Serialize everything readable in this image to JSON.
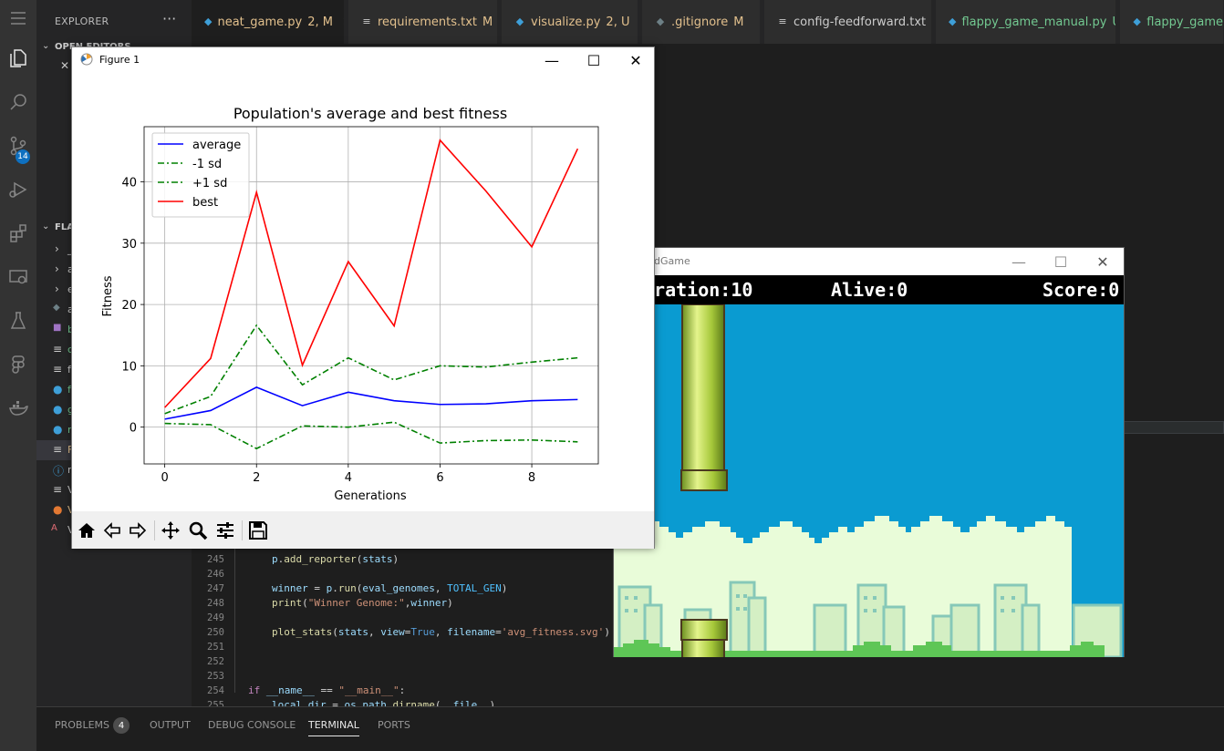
{
  "sidebar": {
    "title": "EXPLORER",
    "more": "···",
    "open_editors": "OPEN EDITORS",
    "folder": "FLA",
    "rows": [
      "_",
      "a",
      "e",
      "a",
      "b",
      "c",
      "f",
      "f",
      "g",
      "r",
      "F",
      "r",
      "V",
      "V"
    ]
  },
  "activity": {
    "scm_badge": "14"
  },
  "tabs": [
    {
      "label": "neat_game.py",
      "mod": "2, M",
      "icon": "python-icon",
      "close": "✕"
    },
    {
      "label": "requirements.txt",
      "mod": "M",
      "icon": "text-file-icon"
    },
    {
      "label": "visualize.py",
      "mod": "2, U",
      "icon": "python-icon"
    },
    {
      "label": ".gitignore",
      "mod": "M",
      "icon": "git-icon"
    },
    {
      "label": "config-feedforward.txt",
      "mod": "",
      "icon": "text-file-icon"
    },
    {
      "label": "flappy_game_manual.py",
      "mod": "U",
      "icon": "python-icon"
    },
    {
      "label": "flappy_game",
      "mod": "",
      "icon": "python-icon"
    }
  ],
  "editor": {
    "lines": [
      {
        "n": "245",
        "code": "p.add_reporter(stats)"
      },
      {
        "n": "246",
        "code": ""
      },
      {
        "n": "247",
        "code": "winner = p.run(eval_genomes, TOTAL_GEN)"
      },
      {
        "n": "248",
        "code": "print(\"Winner Genome:\",winner)"
      },
      {
        "n": "249",
        "code": ""
      },
      {
        "n": "250",
        "code": "plot_stats(stats, view=True, filename='avg_fitness.svg')"
      },
      {
        "n": "251",
        "code": ""
      },
      {
        "n": "252",
        "code": ""
      },
      {
        "n": "253",
        "code": ""
      },
      {
        "n": "254",
        "code": "if __name__ == \"__main__\":"
      },
      {
        "n": "255",
        "code": "local_dir = os.path.dirname(__file__)"
      }
    ]
  },
  "panel": {
    "tabs": [
      "PROBLEMS",
      "OUTPUT",
      "DEBUG CONSOLE",
      "TERMINAL",
      "PORTS"
    ],
    "problems_count": "4",
    "active": "TERMINAL"
  },
  "figure": {
    "window_title": "Figure 1",
    "minimize": "—",
    "maximize": "☐",
    "close": "✕",
    "toolbar": [
      "home-icon",
      "back-icon",
      "forward-icon",
      "pan-icon",
      "zoom-icon",
      "configure-icon",
      "save-icon"
    ]
  },
  "chart_data": {
    "type": "line",
    "title": "Population's average and best fitness",
    "xlabel": "Generations",
    "ylabel": "Fitness",
    "x": [
      0,
      1,
      2,
      3,
      4,
      5,
      6,
      7,
      8,
      9
    ],
    "xlim": [
      -0.45,
      9.45
    ],
    "ylim": [
      -6,
      49
    ],
    "xticks": [
      0,
      2,
      4,
      6,
      8
    ],
    "yticks": [
      0,
      10,
      20,
      30,
      40
    ],
    "grid": true,
    "legend_position": "upper left",
    "series": [
      {
        "name": "average",
        "color": "#0000ff",
        "style": "solid",
        "values": [
          1.3,
          2.7,
          6.5,
          3.5,
          5.7,
          4.3,
          3.7,
          3.8,
          4.3,
          4.5
        ]
      },
      {
        "name": "-1 sd",
        "color": "#008000",
        "style": "dashdot",
        "values": [
          0.6,
          0.4,
          -3.5,
          0.2,
          0.0,
          0.8,
          -2.6,
          -2.2,
          -2.1,
          -2.4
        ]
      },
      {
        "name": "+1 sd",
        "color": "#008000",
        "style": "dashdot",
        "values": [
          2.2,
          5.0,
          16.6,
          6.9,
          11.3,
          7.7,
          10.0,
          9.8,
          10.6,
          11.3
        ]
      },
      {
        "name": "best",
        "color": "#ff0000",
        "style": "solid",
        "values": [
          3.2,
          11.2,
          38.3,
          10.1,
          27.0,
          16.5,
          46.8,
          38.5,
          29.4,
          45.4
        ]
      }
    ]
  },
  "game": {
    "window_title": "dGame",
    "generation_text": "eration:10",
    "alive_text": "Alive:0",
    "score_text": "Score:0",
    "minimize": "—",
    "maximize": "☐",
    "close": "✕"
  }
}
